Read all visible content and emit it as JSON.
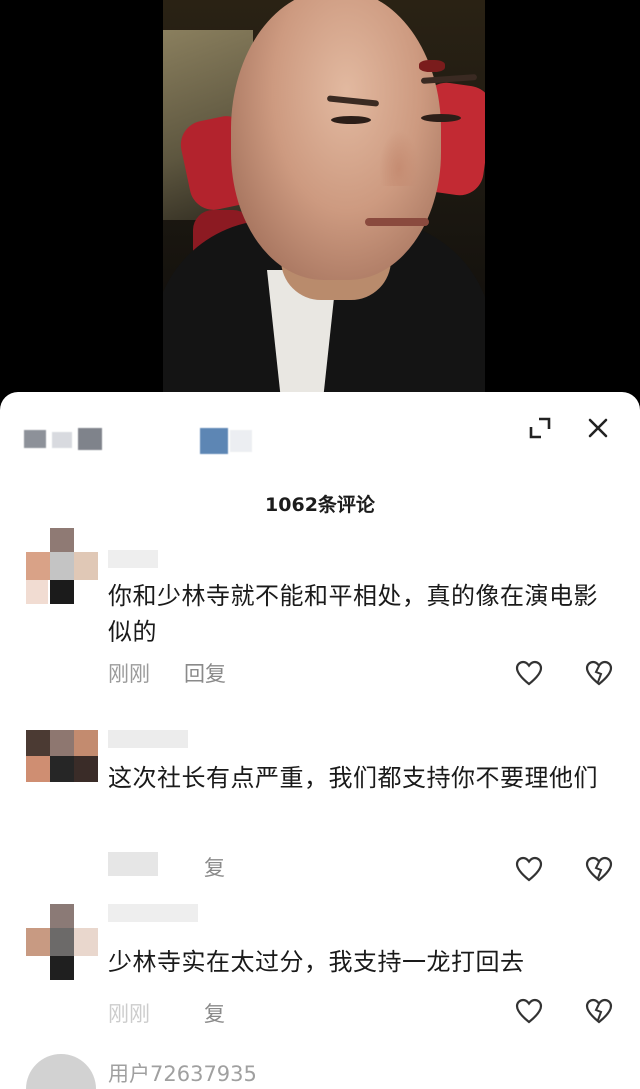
{
  "header": {
    "comment_count_label": "1062条评论"
  },
  "comments": [
    {
      "text": "你和少林寺就不能和平相处，真的像在演电影似的",
      "time": "刚刚",
      "reply_label": "回复"
    },
    {
      "text": "这次社长有点严重，我们都支持你不要理他们",
      "time": "",
      "reply_label": "复"
    },
    {
      "text": "少林寺实在太过分，我支持一龙打回去",
      "time": "刚刚",
      "reply_label": "复"
    }
  ],
  "partial_comment": {
    "username": "用户72637935"
  },
  "icons": {
    "expand": "expand-icon",
    "close": "close-icon",
    "like": "heart-icon",
    "dislike": "broken-heart-icon"
  },
  "colors": {
    "sheet_bg": "#ffffff",
    "text": "#1a1a1a",
    "muted": "#9a9a9a"
  }
}
